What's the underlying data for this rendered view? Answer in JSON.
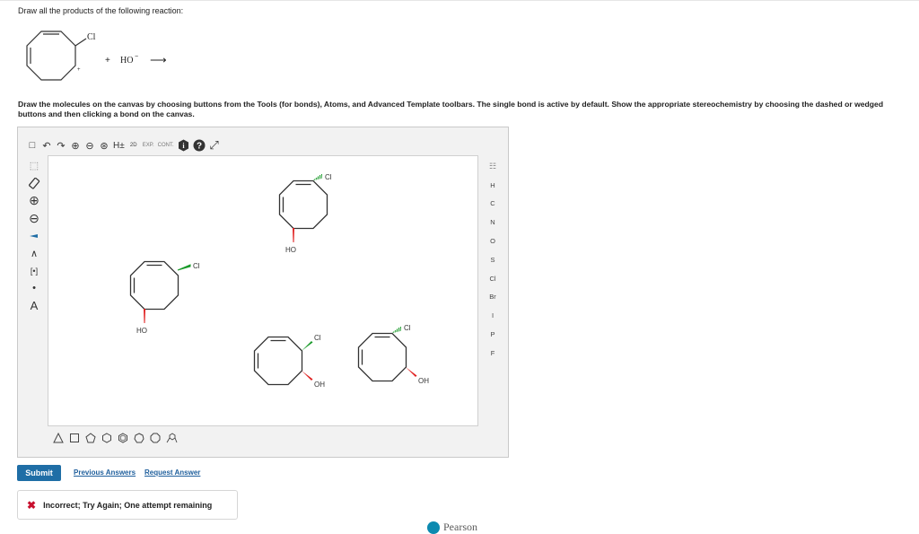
{
  "question": {
    "title": "Draw all the products of the following reaction:",
    "reactant_leaving_group": "Cl",
    "plus_sign": "+",
    "nucleophile": "HO",
    "nucleophile_charge": "−",
    "arrow": "⟶",
    "instructions": "Draw the molecules on the canvas by choosing buttons from the Tools (for bonds), Atoms, and Advanced Template toolbars. The single bond is active by default. Show the appropriate stereochemistry by choosing the dashed or wedged buttons and then clicking a bond on the canvas."
  },
  "toolbar": {
    "new_icon": "□",
    "undo_icon": "↶",
    "redo_icon": "↷",
    "zoom_in_icon": "⊕",
    "zoom_out_icon": "⊖",
    "zoom_reset_icon": "⊛",
    "h_toggle": "H±",
    "two_d": "2D",
    "exp": "EXP.",
    "cont": "CONT.",
    "info_icon": "i",
    "help_icon": "?",
    "fullscreen_icon": "⤢"
  },
  "left_tools": {
    "select_icon": "⬚",
    "eraser_icon": "⊘",
    "plus_charge_icon": "⊕",
    "minus_charge_icon": "⊖",
    "bond_icon": "━",
    "chain_icon": "∧",
    "bracket_icon": "[•]",
    "dot_icon": "•",
    "atom_label_icon": "A"
  },
  "atoms": [
    "H",
    "C",
    "N",
    "O",
    "S",
    "Cl",
    "Br",
    "I",
    "P",
    "F"
  ],
  "periodic_table_icon": "☷",
  "templates": [
    "triangle",
    "square",
    "pentagon",
    "hexagon",
    "hexagon-flat",
    "heptagon",
    "octagon",
    "template-more"
  ],
  "molecules": {
    "m1": {
      "sub_label": "Cl"
    },
    "m2": {
      "sub_label": "Cl",
      "oh_label": "HO"
    },
    "m3": {
      "sub_label": "Cl",
      "oh_label": "HO"
    },
    "m4": {
      "cl_label": "Cl",
      "oh_label": "OH"
    },
    "m5": {
      "cl_label": "Cl",
      "oh_label": "OH"
    }
  },
  "actions": {
    "submit": "Submit",
    "previous_answers": "Previous Answers",
    "request_answer": "Request Answer"
  },
  "feedback": {
    "icon": "✖",
    "text": "Incorrect; Try Again; One attempt remaining"
  },
  "brand": "Pearson",
  "colors": {
    "submit_bg": "#1f6ea6",
    "link": "#1f5f9c",
    "error": "#c8102e",
    "wedge_red": "#e02020",
    "wedge_green": "#1a9a2a"
  }
}
